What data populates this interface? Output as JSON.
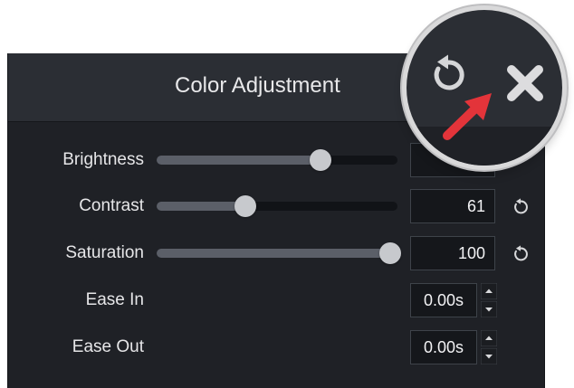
{
  "panel": {
    "title": "Color Adjustment"
  },
  "rows": [
    {
      "label": "Brightness",
      "value_display": "",
      "slider_fraction": 0.68
    },
    {
      "label": "Contrast",
      "value_display": "61",
      "slider_fraction": 0.37
    },
    {
      "label": "Saturation",
      "value_display": "100",
      "slider_fraction": 0.97
    },
    {
      "label": "Ease In",
      "value_display": "0.00s"
    },
    {
      "label": "Ease Out",
      "value_display": "0.00s"
    }
  ],
  "icons": {
    "reset": "reset-icon",
    "close": "close-icon",
    "arrow": "arrow-icon",
    "spin_up": "chevron-up-icon",
    "spin_down": "chevron-down-icon"
  },
  "colors": {
    "panel_bg": "#1f2126",
    "header_bg": "#2b2e34",
    "text": "#e6e6e8",
    "slider_track": "#111317",
    "slider_fill": "#5b5f68",
    "slider_thumb": "#c7c9cd",
    "close_icon": "#d9d9db",
    "arrow": "#e3343a"
  }
}
